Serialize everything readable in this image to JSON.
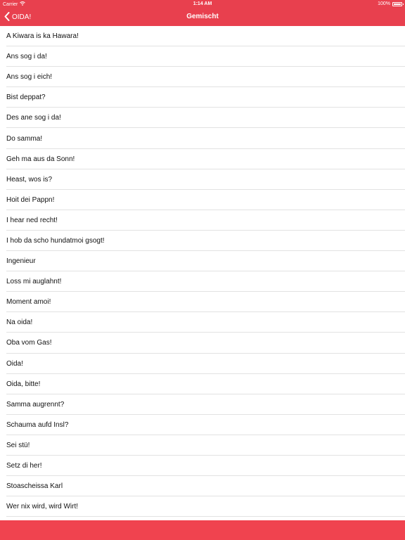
{
  "status_bar": {
    "carrier": "Carrier",
    "wifi_icon": "wifi-icon",
    "time": "1:14 AM",
    "battery_percent": "100%",
    "battery_icon": "battery-icon"
  },
  "nav": {
    "back_label": "OIDA!",
    "back_icon": "chevron-left-icon",
    "title": "Gemischt"
  },
  "colors": {
    "bar": "#e8404e",
    "bottom_bar": "#f0434f",
    "separator": "#e2e2e2",
    "text": "#111111"
  },
  "items": [
    "A Kiwara is ka Hawara!",
    "Ans sog i da!",
    "Ans sog i eich!",
    "Bist deppat?",
    "Des ane sog i da!",
    "Do samma!",
    "Geh ma aus da Sonn!",
    "Heast, wos is?",
    "Hoit dei Pappn!",
    "I hear ned recht!",
    "I hob da scho hundatmoi gsogt!",
    "Ingenieur",
    "Loss mi auglahnt!",
    "Moment amoi!",
    "Na oida!",
    "Oba vom Gas!",
    "Oida!",
    "Oida, bitte!",
    "Samma augrennt?",
    "Schauma aufd Insl?",
    "Sei stü!",
    "Setz di her!",
    "Stoascheissa Karl",
    "Wer nix wird, wird Wirt!"
  ]
}
